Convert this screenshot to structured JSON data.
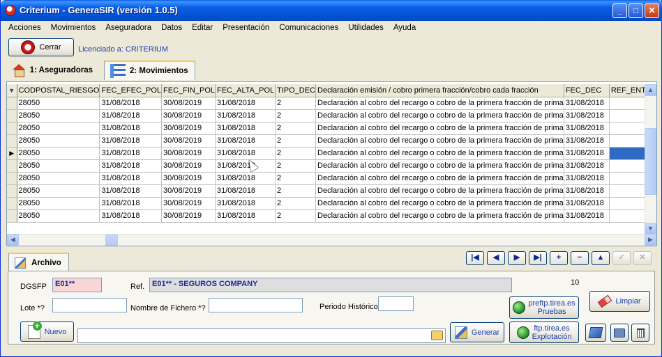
{
  "window": {
    "title": "Criterium - GeneraSIR (versión 1.0.5)",
    "min": "_",
    "max": "□",
    "close": "✕"
  },
  "menu": [
    "Acciones",
    "Movimientos",
    "Aseguradora",
    "Datos",
    "Editar",
    "Presentación",
    "Comunicaciones",
    "Utilidades",
    "Ayuda"
  ],
  "toolbar": {
    "cerrar_label": "Cerrar",
    "licensed": "Licenciado a: CRITERIUM"
  },
  "tabs": [
    {
      "label": "1: Aseguradoras",
      "icon": "house-icon"
    },
    {
      "label": "2: Movimientos",
      "icon": "list-icon",
      "active": true
    }
  ],
  "grid": {
    "columns": [
      "CODPOSTAL_RIESGO",
      "FEC_EFEC_POL",
      "FEC_FIN_POL",
      "FEC_ALTA_POL",
      "TIPO_DEC",
      "Declaración emisión / cobro primera fracción/cobro cada fracción",
      "FEC_DEC",
      "REF_ENT_1"
    ],
    "rows": [
      [
        "28050",
        "31/08/2018",
        "30/08/2019",
        "31/08/2018",
        "2",
        "Declaración al cobro del recargo o cobro de la primera fracción de prima",
        "31/08/2018",
        ""
      ],
      [
        "28050",
        "31/08/2018",
        "30/08/2019",
        "31/08/2018",
        "2",
        "Declaración al cobro del recargo o cobro de la primera fracción de prima",
        "31/08/2018",
        ""
      ],
      [
        "28050",
        "31/08/2018",
        "30/08/2019",
        "31/08/2018",
        "2",
        "Declaración al cobro del recargo o cobro de la primera fracción de prima",
        "31/08/2018",
        ""
      ],
      [
        "28050",
        "31/08/2018",
        "30/08/2019",
        "31/08/2018",
        "2",
        "Declaración al cobro del recargo o cobro de la primera fracción de prima",
        "31/08/2018",
        ""
      ],
      [
        "28050",
        "31/08/2018",
        "30/08/2019",
        "31/08/2018",
        "2",
        "Declaración al cobro del recargo o cobro de la primera fracción de prima",
        "31/08/2018",
        ""
      ],
      [
        "28050",
        "31/08/2018",
        "30/08/2019",
        "31/08/2018",
        "2",
        "Declaración al cobro del recargo o cobro de la primera fracción de prima",
        "31/08/2018",
        ""
      ],
      [
        "28050",
        "31/08/2018",
        "30/08/2019",
        "31/08/2018",
        "2",
        "Declaración al cobro del recargo o cobro de la primera fracción de prima",
        "31/08/2018",
        ""
      ],
      [
        "28050",
        "31/08/2018",
        "30/08/2019",
        "31/08/2018",
        "2",
        "Declaración al cobro del recargo o cobro de la primera fracción de prima",
        "31/08/2018",
        ""
      ],
      [
        "28050",
        "31/08/2018",
        "30/08/2019",
        "31/08/2018",
        "2",
        "Declaración al cobro del recargo o cobro de la primera fracción de prima",
        "31/08/2018",
        ""
      ],
      [
        "28050",
        "31/08/2018",
        "30/08/2019",
        "31/08/2018",
        "2",
        "Declaración al cobro del recargo o cobro de la primera fracción de prima",
        "31/08/2018",
        ""
      ]
    ],
    "current_row": 4
  },
  "archivo": {
    "tab_label": "Archivo",
    "nav": [
      "|◀",
      "◀",
      "▶",
      "▶|",
      "+",
      "−",
      "▲",
      "✓",
      "✕"
    ],
    "dgsfp_label": "DGSFP",
    "dgsfp_value": "E01**",
    "ref_label": "Ref.",
    "ref_value": "E01** - SEGUROS COMPANY",
    "count": "10",
    "lote_label": "Lote *?",
    "lote_value": "",
    "nombre_label": "Nombre de Fichero *?",
    "nombre_value": "",
    "periodo_label": "Periodo Histórico",
    "periodo_value": "",
    "pruebas_line1": "preftp.tirea.es",
    "pruebas_line2": "Pruebas",
    "limpiar_label": "Limpiar",
    "nuevo_label": "Nuevo",
    "path_value": "",
    "generar_label": "Generar",
    "explot_line1": "ftp.tirea.es",
    "explot_line2": "Explotación"
  }
}
